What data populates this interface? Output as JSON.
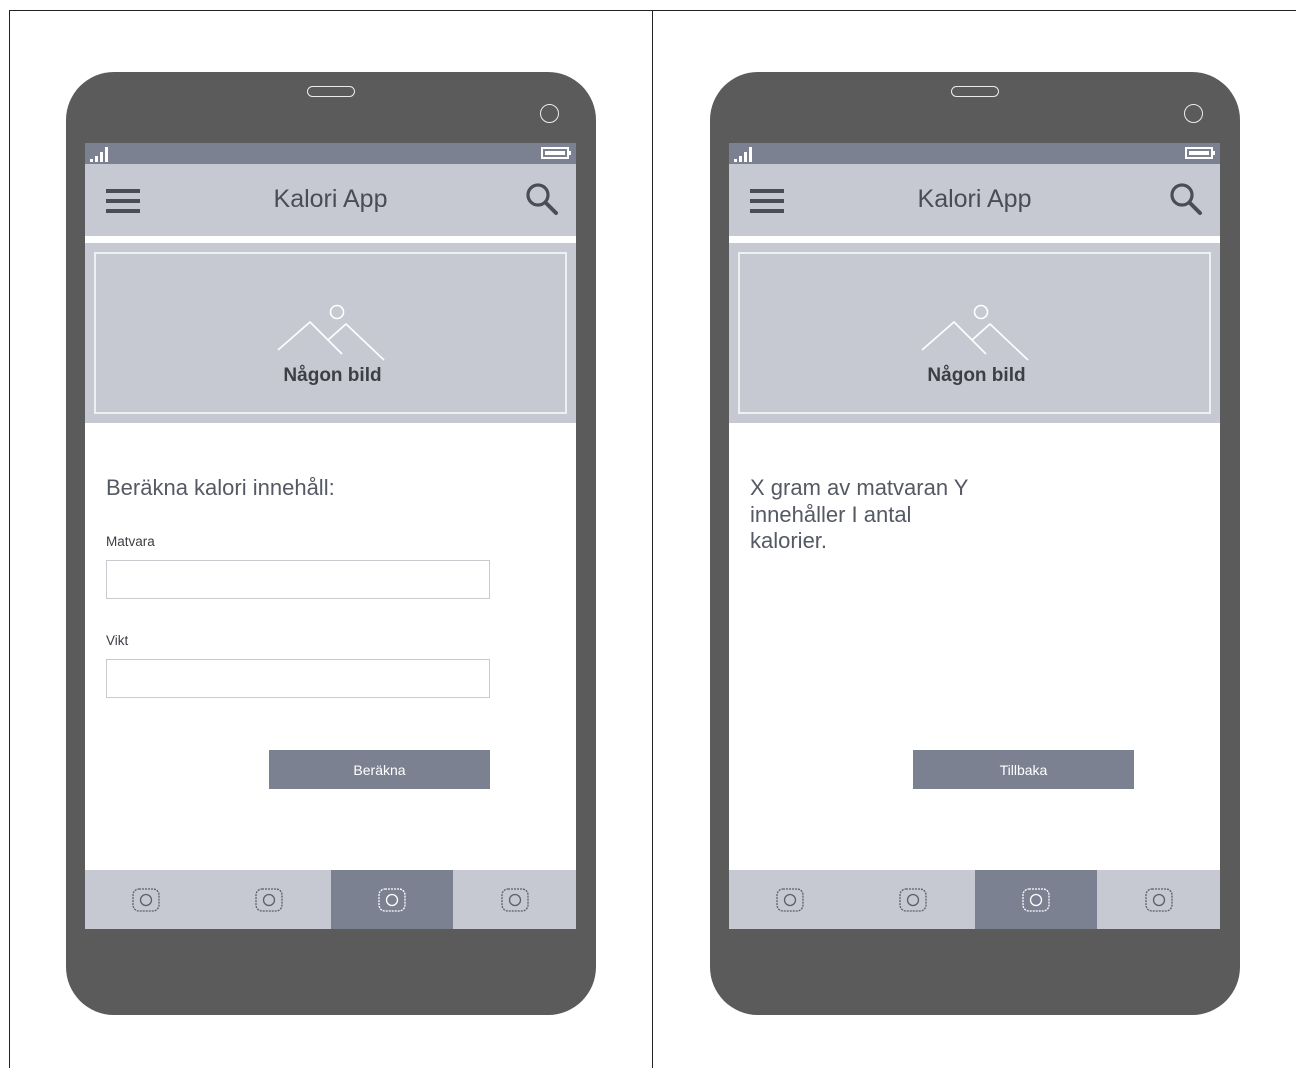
{
  "screens": [
    {
      "status": {
        "signal_icon": "signal-bars-icon",
        "battery_icon": "battery-icon"
      },
      "appbar": {
        "title": "Kalori App",
        "menu_icon": "hamburger-menu-icon",
        "search_icon": "search-icon"
      },
      "hero": {
        "caption": "Någon bild",
        "image_icon": "image-placeholder-icon"
      },
      "form": {
        "heading": "Beräkna kalori innehåll:",
        "fields": [
          {
            "label": "Matvara",
            "value": ""
          },
          {
            "label": "Vikt",
            "value": ""
          }
        ],
        "button_label": "Beräkna"
      },
      "tabs": {
        "count": 4,
        "active_index": 2
      }
    },
    {
      "status": {
        "signal_icon": "signal-bars-icon",
        "battery_icon": "battery-icon"
      },
      "appbar": {
        "title": "Kalori App",
        "menu_icon": "hamburger-menu-icon",
        "search_icon": "search-icon"
      },
      "hero": {
        "caption": "Någon bild",
        "image_icon": "image-placeholder-icon"
      },
      "result": {
        "lines": [
          "X gram av matvaran Y",
          "innehåller I antal",
          "kalorier."
        ]
      },
      "button_label": "Tillbaka",
      "tabs": {
        "count": 4,
        "active_index": 2
      }
    }
  ],
  "colors": {
    "phone_body": "#5a5b5a",
    "status_bar": "#7b8191",
    "app_bar": "#c6c9d2",
    "button": "#7b8191",
    "active_tab": "#7b8191"
  }
}
